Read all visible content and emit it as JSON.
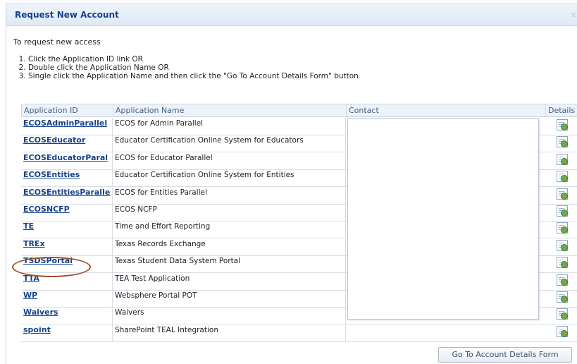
{
  "dialog": {
    "title": "Request New Account",
    "close_glyph": "×"
  },
  "intro": "To request new access",
  "steps": [
    "Click the Application ID link OR",
    "Double click the Application Name OR",
    "Single click the Application Name and then click the \"Go To Account Details Form\" button"
  ],
  "grid": {
    "headers": {
      "id": "Application ID",
      "name": "Application Name",
      "contact": "Contact",
      "details": "Details"
    },
    "rows": [
      {
        "id": "ECOSAdminParallel",
        "name": "ECOS for Admin Parallel"
      },
      {
        "id": "ECOSEducator",
        "name": "Educator Certification Online System for Educators"
      },
      {
        "id": "ECOSEducatorParal",
        "name": "ECOS for Educator Parallel"
      },
      {
        "id": "ECOSEntities",
        "name": "Educator Certification Online System for Entities"
      },
      {
        "id": "ECOSEntitiesParalle",
        "name": "ECOS for Entities Parallel"
      },
      {
        "id": "ECOSNCFP",
        "name": "ECOS NCFP"
      },
      {
        "id": "TE",
        "name": "Time and Effort Reporting"
      },
      {
        "id": "TREx",
        "name": "Texas Records Exchange"
      },
      {
        "id": "TSDSPortal",
        "name": "Texas Student Data System Portal"
      },
      {
        "id": "TTA",
        "name": "TEA Test Application"
      },
      {
        "id": "WP",
        "name": "Websphere Portal POT"
      },
      {
        "id": "Waivers",
        "name": "Waivers"
      },
      {
        "id": "spoint",
        "name": "SharePoint TEAL Integration"
      }
    ],
    "details_icon": "details-document-icon"
  },
  "annotation": {
    "highlighted_row": "TSDSPortal",
    "color": "#a0522d"
  },
  "buttons": {
    "go": "Go To Account Details Form"
  }
}
